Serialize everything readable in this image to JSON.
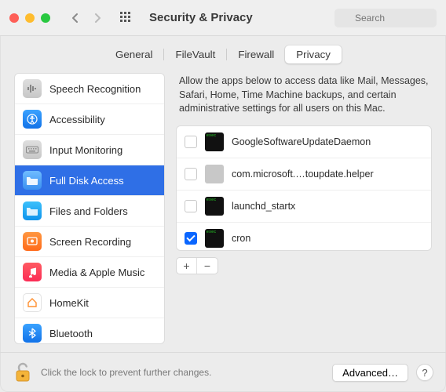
{
  "window": {
    "title": "Security & Privacy",
    "search_placeholder": "Search"
  },
  "tabs": [
    {
      "label": "General"
    },
    {
      "label": "FileVault"
    },
    {
      "label": "Firewall"
    },
    {
      "label": "Privacy",
      "active": true
    }
  ],
  "sidebar": {
    "items": [
      {
        "label": "Speech Recognition",
        "icon": "waveform",
        "color": "si-gray"
      },
      {
        "label": "Accessibility",
        "icon": "accessibility",
        "color": "si-blue"
      },
      {
        "label": "Input Monitoring",
        "icon": "keyboard",
        "color": "si-gray"
      },
      {
        "label": "Full Disk Access",
        "icon": "folder",
        "color": "si-folder",
        "selected": true
      },
      {
        "label": "Files and Folders",
        "icon": "folder",
        "color": "si-blue2"
      },
      {
        "label": "Screen Recording",
        "icon": "record",
        "color": "si-orange"
      },
      {
        "label": "Media & Apple Music",
        "icon": "music",
        "color": "si-red"
      },
      {
        "label": "HomeKit",
        "icon": "home",
        "color": "si-white"
      },
      {
        "label": "Bluetooth",
        "icon": "bluetooth",
        "color": "si-blue"
      }
    ]
  },
  "panel": {
    "description": "Allow the apps below to access data like Mail, Messages, Safari, Home, Time Machine backups, and certain administrative settings for all users on this Mac.",
    "apps": [
      {
        "name": "GoogleSoftwareUpdateDaemon",
        "checked": false,
        "icon": "exec"
      },
      {
        "name": "com.microsoft.…toupdate.helper",
        "checked": false,
        "icon": "gray"
      },
      {
        "name": "launchd_startx",
        "checked": false,
        "icon": "exec"
      },
      {
        "name": "cron",
        "checked": true,
        "icon": "exec"
      }
    ]
  },
  "footer": {
    "lock_text": "Click the lock to prevent further changes.",
    "advanced_label": "Advanced…"
  }
}
